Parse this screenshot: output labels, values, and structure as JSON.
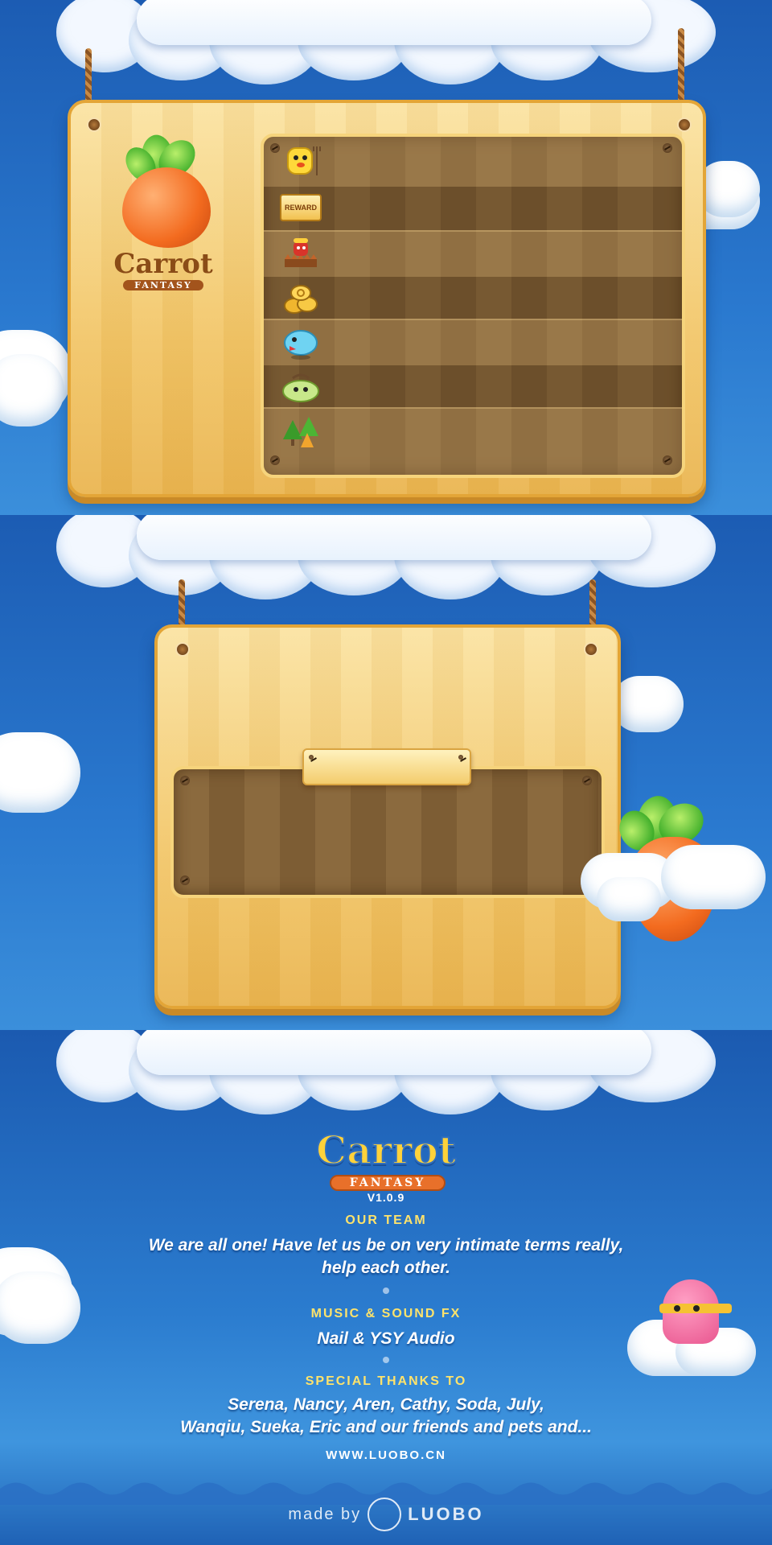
{
  "colors": {
    "sky": "#2a79cf",
    "wood": "#f2c668",
    "wood_inset": "#8b6a3e",
    "header_yellow": "#ffe36b",
    "carrot_orange": "#f36b1f"
  },
  "panel1": {
    "logo": {
      "title": "Carrot",
      "subtitle": "FANTASY"
    },
    "menu_items": [
      {
        "icon": "chick-monster-icon",
        "badge": ""
      },
      {
        "icon": "reward-sign-icon",
        "badge": "REWARD"
      },
      {
        "icon": "red-tower-icon",
        "badge": ""
      },
      {
        "icon": "coin-stack-icon",
        "badge": ""
      },
      {
        "icon": "blue-bird-icon",
        "badge": ""
      },
      {
        "icon": "green-sheep-icon",
        "badge": ""
      },
      {
        "icon": "pine-trees-icon",
        "badge": ""
      }
    ]
  },
  "panel2": {
    "mascot": "carrot-in-cloud-icon"
  },
  "panel3": {
    "logo": {
      "title": "Carrot",
      "subtitle": "FANTASY"
    },
    "version": "V1.0.9",
    "team_header": "OUR TEAM",
    "team_line1": "We are all one! Have let us be on very intimate terms really,",
    "team_line2": "help each other.",
    "music_header": "MUSIC & SOUND FX",
    "music_text": "Nail & YSY Audio",
    "thanks_header": "SPECIAL THANKS TO",
    "thanks_line1": "Serena, Nancy, Aren, Cathy, Soda, July,",
    "thanks_line2": "Wanqiu, Sueka, Eric and our friends and pets and...",
    "website": "WWW.LUOBO.CN",
    "made_by": "made by",
    "brand": "LUOBO"
  }
}
